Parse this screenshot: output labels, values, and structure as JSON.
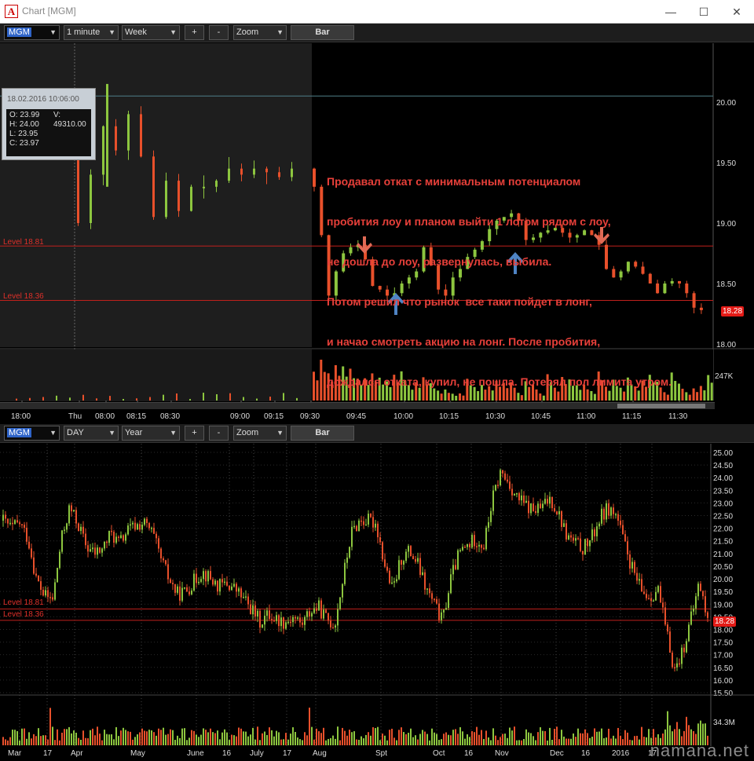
{
  "window": {
    "title": "Chart [MGM]",
    "icon_letter": "A",
    "minimize_glyph": "—",
    "maximize_glyph": "☐",
    "close_glyph": "✕"
  },
  "top_toolbar": {
    "symbol": "MGM",
    "interval": "1 minute",
    "range": "Week",
    "plus": "+",
    "minus": "-",
    "zoom": "Zoom",
    "mode": "Bar"
  },
  "bottom_toolbar": {
    "symbol": "MGM",
    "interval": "DAY",
    "range": "Year",
    "plus": "+",
    "minus": "-",
    "zoom": "Zoom",
    "mode": "Bar"
  },
  "info_box": {
    "datetime": "18.02.2016 10:06:00",
    "open": "O: 23.99",
    "high": "H: 24.00",
    "low": "L: 23.95",
    "close": "C: 23.97",
    "volume_label": "V:",
    "volume": "49310.00"
  },
  "annotation": {
    "lines": [
      "Продавал откат с минимальным потенциалом",
      "пробития лоу и планом выйти 1 лотом рядом с лоу,",
      "не дошла до лоу, развернулась, выбила.",
      "Потом решил что рынок  все таки пойдет в лонг,",
      "и начао смотреть акцию на лонг. После пробития,",
      "дождался отката, купил, не пошла. Потерял пол лимита утром."
    ]
  },
  "colors": {
    "up": "#8dc63f",
    "down": "#e8502b",
    "level": "#e0302a",
    "arrow_red": "#e06a55",
    "arrow_blue": "#4f84c4"
  },
  "intraday_chart": {
    "type": "bar",
    "price_axis_labels": [
      "20.00",
      "19.50",
      "19.00",
      "18.50",
      "18.00"
    ],
    "ylim": [
      18.0,
      20.0
    ],
    "levels": [
      {
        "label": "Level 18.81",
        "value": 18.81
      },
      {
        "label": "Level 18.36",
        "value": 18.36
      }
    ],
    "last_price": "18.28",
    "volume_label": "247K",
    "time_labels": [
      "18:00",
      "Thu",
      "08:00",
      "08:15",
      "08:30",
      "09:00",
      "09:15",
      "09:30",
      "09:45",
      "10:00",
      "10:15",
      "10:30",
      "10:45",
      "11:00",
      "11:15",
      "11:30"
    ],
    "arrows": [
      {
        "direction": "down",
        "color": "red"
      },
      {
        "direction": "up",
        "color": "blue"
      },
      {
        "direction": "up",
        "color": "blue"
      },
      {
        "direction": "down",
        "color": "red"
      }
    ],
    "closes_premarket": [
      19.75,
      19.0,
      19.4,
      19.8,
      19.6,
      19.9,
      19.55,
      19.05,
      19.35,
      19.1,
      19.3,
      19.3,
      19.35,
      19.45,
      19.4,
      19.45,
      19.42,
      19.38,
      19.45
    ],
    "closes_session": [
      19.3,
      18.9,
      18.4,
      18.6,
      18.75,
      18.8,
      18.82,
      18.7,
      18.48,
      18.45,
      18.4,
      18.42,
      18.5,
      18.55,
      18.6,
      18.8,
      18.65,
      18.45,
      18.4,
      18.55,
      18.62,
      18.72,
      18.78,
      18.85,
      18.95,
      19.02,
      19.05,
      19.08,
      19.02,
      18.86,
      18.88,
      18.92,
      18.94,
      18.96,
      18.92,
      18.88,
      18.9,
      18.94,
      18.9,
      18.82,
      18.62,
      18.55,
      18.6,
      18.68,
      18.64,
      18.58,
      18.5,
      18.42,
      18.5,
      18.52,
      18.5,
      18.42,
      18.3,
      18.28
    ]
  },
  "daily_chart": {
    "type": "bar",
    "price_axis_labels": [
      "25.00",
      "24.50",
      "24.00",
      "23.50",
      "23.00",
      "22.50",
      "22.00",
      "21.50",
      "21.00",
      "20.50",
      "20.00",
      "19.50",
      "19.00",
      "18.50",
      "18.00",
      "17.50",
      "17.00",
      "16.50",
      "16.00",
      "15.50"
    ],
    "ylim": [
      15.5,
      25.0
    ],
    "levels": [
      {
        "label": "Level 18.81",
        "value": 18.81
      },
      {
        "label": "Level 18.36",
        "value": 18.36
      }
    ],
    "last_price": "18.28",
    "volume_label": "34.3M",
    "time_labels": [
      "Mar",
      "17",
      "Apr",
      "May",
      "June",
      "16",
      "July",
      "17",
      "Aug",
      "Spt",
      "Oct",
      "16",
      "Nov",
      "Dec",
      "16",
      "2016",
      "17"
    ],
    "closes": [
      22.3,
      22.0,
      22.2,
      21.6,
      20.0,
      19.3,
      19.2,
      21.5,
      22.8,
      22.2,
      21.3,
      21.0,
      21.2,
      21.8,
      21.4,
      21.9,
      22.1,
      22.2,
      21.8,
      20.8,
      20.0,
      19.4,
      19.5,
      19.9,
      20.3,
      20.0,
      19.7,
      19.8,
      19.6,
      19.2,
      18.8,
      18.3,
      18.6,
      18.4,
      18.3,
      18.5,
      18.2,
      18.7,
      18.9,
      18.4,
      18.2,
      20.0,
      21.8,
      22.3,
      22.3,
      22.2,
      20.6,
      19.5,
      20.8,
      21.1,
      20.6,
      19.6,
      19.0,
      18.3,
      20.0,
      21.0,
      21.3,
      21.6,
      21.3,
      23.1,
      24.2,
      23.8,
      23.2,
      22.9,
      22.7,
      22.8,
      23.2,
      22.6,
      21.7,
      21.4,
      21.2,
      21.6,
      22.4,
      22.8,
      22.5,
      21.3,
      20.3,
      19.5,
      19.3,
      19.6,
      17.9,
      16.4,
      17.2,
      18.4,
      19.9,
      18.3
    ]
  },
  "watermark": "namana.net"
}
